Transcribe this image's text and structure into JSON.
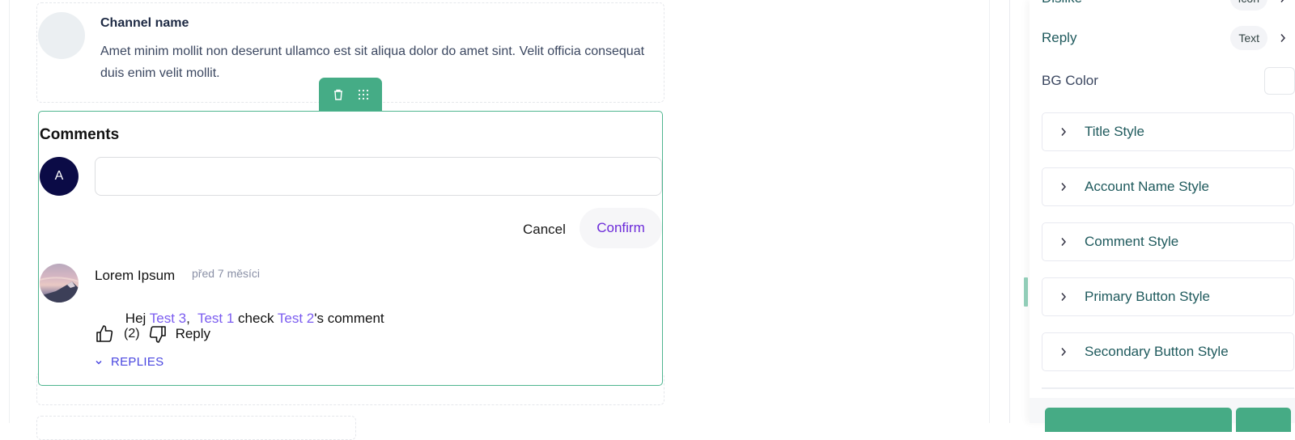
{
  "channel": {
    "name": "Channel name",
    "description": "Amet minim mollit non deserunt ullamco est sit aliqua dolor do amet sint. Velit officia consequat duis enim velit mollit."
  },
  "block_toolbar": {
    "icons": [
      "trash-icon",
      "drag-grid-icon"
    ]
  },
  "comments": {
    "title": "Comments",
    "current_user_initial": "A",
    "input_value": "",
    "input_placeholder": "",
    "cancel_label": "Cancel",
    "confirm_label": "Confirm",
    "items": [
      {
        "author": "Lorem Ipsum",
        "time": "před 7 měsíci",
        "text_parts": [
          {
            "text": "Hej ",
            "mention": false
          },
          {
            "text": "Test 3",
            "mention": true
          },
          {
            "text": ",  ",
            "mention": false
          },
          {
            "text": "Test 1",
            "mention": true
          },
          {
            "text": " check ",
            "mention": false
          },
          {
            "text": "Test 2",
            "mention": true
          },
          {
            "text": "'s comment",
            "mention": false
          }
        ],
        "like_count": "(2)",
        "reply_label": "Reply",
        "replies_label": "REPLIES"
      }
    ]
  },
  "panel": {
    "rows": [
      {
        "label": "Dislike",
        "chip": "Icon"
      },
      {
        "label": "Reply",
        "chip": "Text"
      }
    ],
    "bg_color_label": "BG Color",
    "bg_color_value": "#ffffff",
    "sections": [
      "Title Style",
      "Account Name Style",
      "Comment Style",
      "Primary Button Style",
      "Secondary Button Style"
    ]
  },
  "colors": {
    "accent_green": "#45ac86",
    "mention_purple": "#7b5cf0",
    "confirm_purple": "#6c2bd9",
    "replies_blue": "#4a47e0",
    "avatar_navy": "#0b0b46",
    "panel_text_teal": "#1f5a5d"
  }
}
